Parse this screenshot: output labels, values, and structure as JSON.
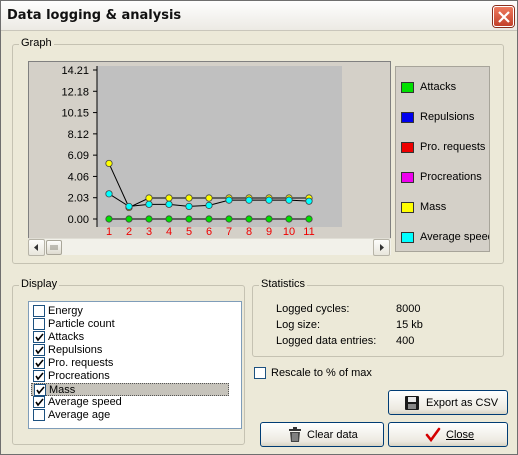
{
  "window": {
    "title": "Data logging & analysis"
  },
  "graph": {
    "group_label": "Graph",
    "legend": [
      {
        "label": "Attacks",
        "color": "#00e000"
      },
      {
        "label": "Repulsions",
        "color": "#0000ee"
      },
      {
        "label": "Pro. requests",
        "color": "#ee0000"
      },
      {
        "label": "Procreations",
        "color": "#ee00ee"
      },
      {
        "label": "Mass",
        "color": "#ffff00"
      },
      {
        "label": "Average speed",
        "color": "#00ffff"
      }
    ]
  },
  "chart_data": {
    "type": "line",
    "x": [
      1,
      2,
      3,
      4,
      5,
      6,
      7,
      8,
      9,
      10,
      11
    ],
    "yticks": [
      "14.21",
      "12.18",
      "10.15",
      "8.12",
      "6.09",
      "4.06",
      "2.03",
      "0.00"
    ],
    "ylim": [
      0,
      14.21
    ],
    "grid": false,
    "legend_position": "right",
    "series": [
      {
        "name": "Attacks",
        "color": "#00e000",
        "values": [
          0,
          0,
          0,
          0,
          0,
          0,
          0,
          0,
          0,
          0,
          0
        ]
      },
      {
        "name": "Mass",
        "color": "#ffff00",
        "values": [
          5.3,
          1.1,
          2.0,
          2.0,
          2.0,
          2.0,
          2.0,
          2.0,
          2.0,
          2.0,
          2.0
        ]
      },
      {
        "name": "Average speed",
        "color": "#00ffff",
        "values": [
          2.4,
          1.2,
          1.4,
          1.4,
          1.2,
          1.3,
          1.8,
          1.8,
          1.8,
          1.8,
          1.7
        ]
      }
    ]
  },
  "display": {
    "group_label": "Display",
    "items": [
      {
        "label": "Energy",
        "checked": false
      },
      {
        "label": "Particle count",
        "checked": false
      },
      {
        "label": "Attacks",
        "checked": true
      },
      {
        "label": "Repulsions",
        "checked": true
      },
      {
        "label": "Pro. requests",
        "checked": true
      },
      {
        "label": "Procreations",
        "checked": true
      },
      {
        "label": "Mass",
        "checked": true,
        "selected": true
      },
      {
        "label": "Average speed",
        "checked": true
      },
      {
        "label": "Average age",
        "checked": false
      }
    ]
  },
  "statistics": {
    "group_label": "Statistics",
    "rows": [
      {
        "label": "Logged cycles:",
        "value": "8000"
      },
      {
        "label": "Log size:",
        "value": "15 kb"
      },
      {
        "label": "Logged data entries:",
        "value": "400"
      }
    ]
  },
  "rescale": {
    "label": "Rescale to % of max",
    "checked": false
  },
  "buttons": {
    "export": "Export as CSV",
    "clear": "Clear data",
    "close": "Close"
  }
}
